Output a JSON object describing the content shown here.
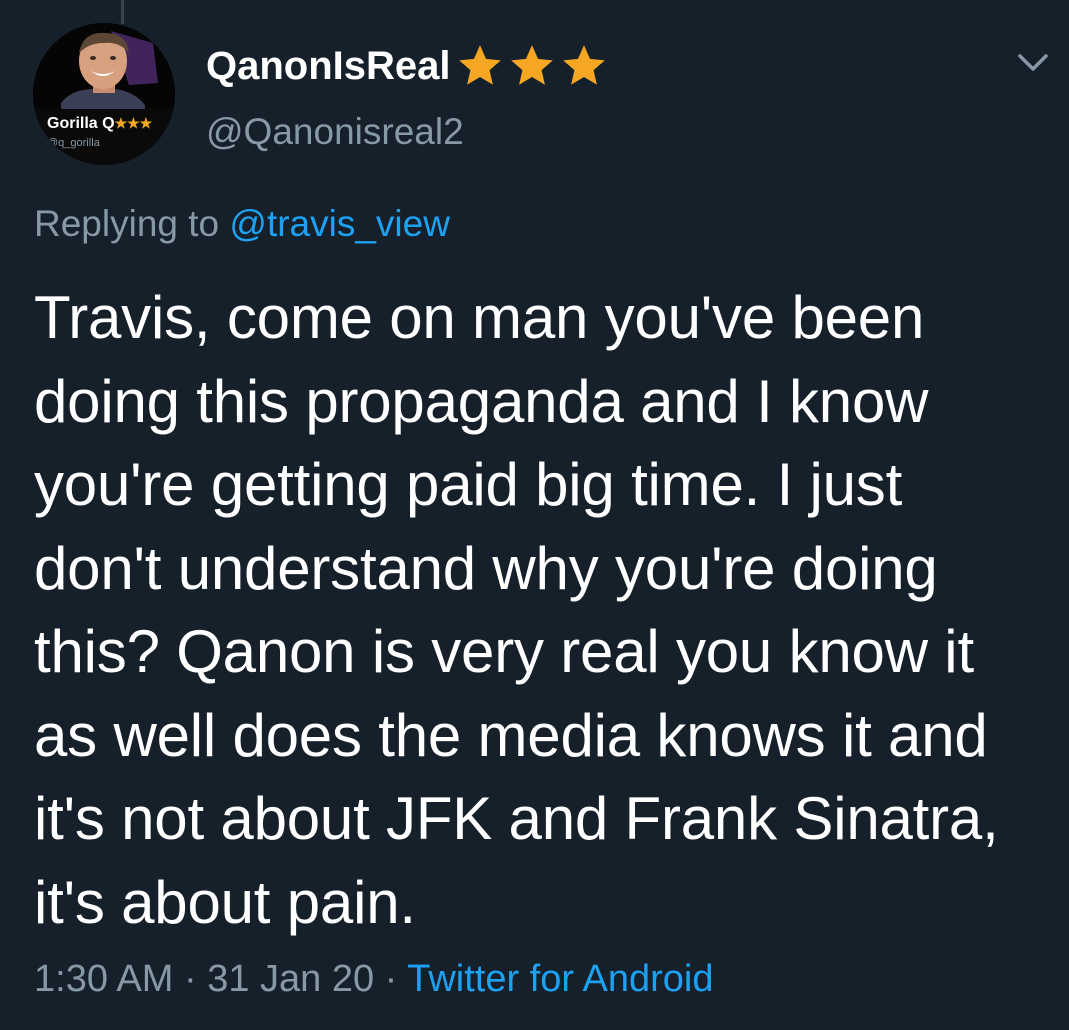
{
  "user": {
    "display_name": "QanonIsReal",
    "handle": "@Qanonisreal2",
    "verified_stars": 3,
    "star_color": "#f5a623",
    "avatar": {
      "name_text": "Gorilla Q",
      "handle_text": "@q_gorilla"
    }
  },
  "reply": {
    "prefix": "Replying to ",
    "to_handle": "@travis_view"
  },
  "tweet": {
    "text": "Travis, come on man you've been doing this propaganda and I know you're getting paid big time. I just don't understand why you're doing this? Qanon is very real you know it as well does the media knows it and it's not about JFK and Frank Sinatra, it's about pain."
  },
  "meta": {
    "time": "1:30 AM",
    "separator": " · ",
    "date": "31 Jan 20",
    "source": "Twitter for Android"
  },
  "icons": {
    "menu": "chevron-down-icon",
    "star": "star-icon"
  },
  "colors": {
    "background": "#15202b",
    "primary_text": "#ffffff",
    "secondary_text": "#8899a6",
    "link": "#1da1f2"
  }
}
